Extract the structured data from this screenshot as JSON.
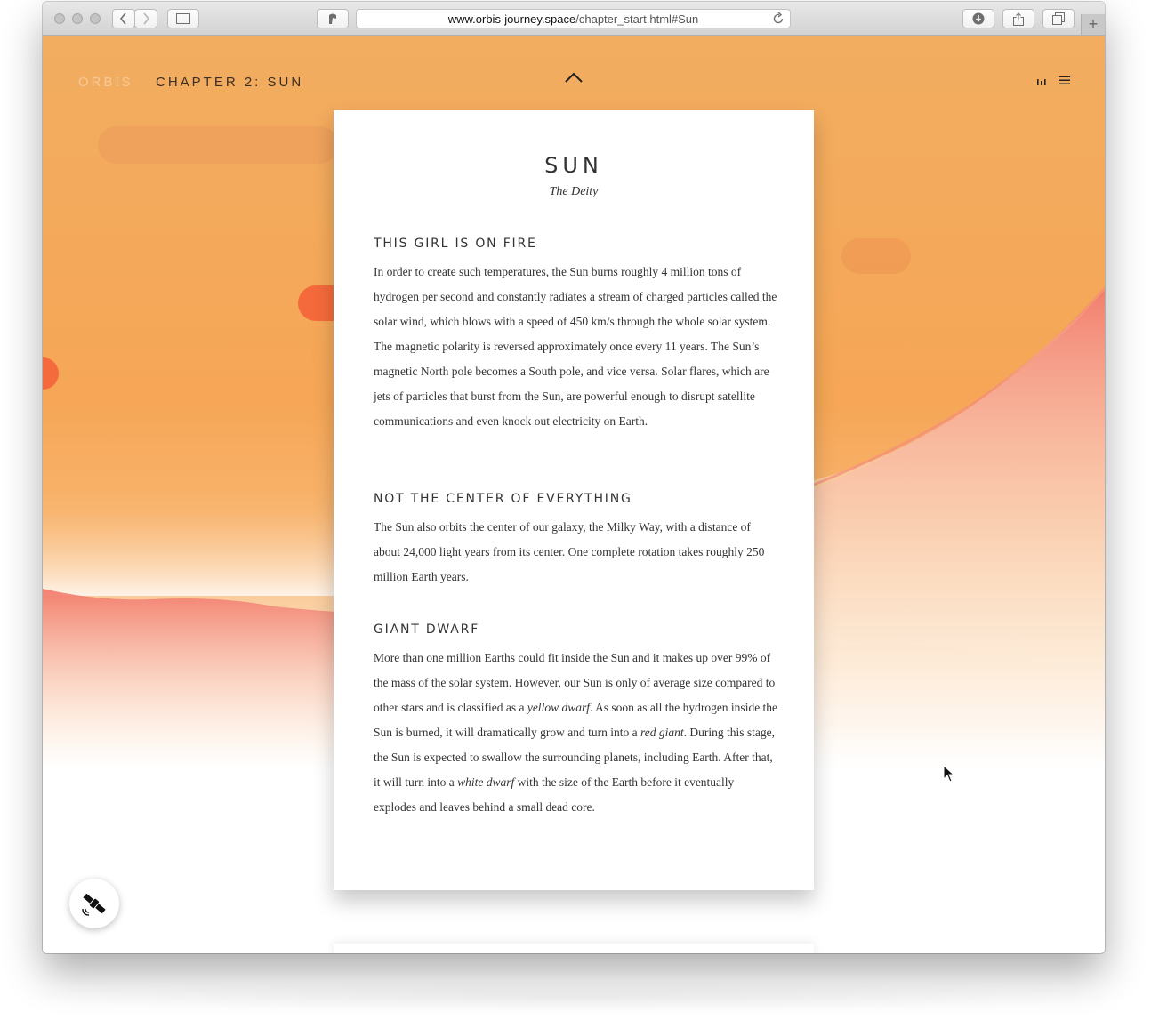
{
  "browser": {
    "url_host": "www.orbis-journey.space",
    "url_path": "/chapter_start.html#Sun"
  },
  "header": {
    "brand": "ORBIS",
    "chapter": "CHAPTER 2: SUN"
  },
  "card": {
    "title": "SUN",
    "subtitle": "The Deity",
    "sections": [
      {
        "heading": "THIS GIRL IS ON FIRE",
        "body": "In order to create such temperatures, the Sun burns roughly 4 million tons of hydrogen per second and constantly radiates a stream of charged particles called the solar wind, which blows with a speed of 450 km/s through the whole solar system. The magnetic polarity is reversed approximately once every 11 years. The Sun’s magnetic North pole becomes a South pole, and vice versa. Solar flares, which are jets of particles that burst from the Sun, are powerful enough to disrupt satellite communications and even knock out electricity on Earth."
      },
      {
        "heading": "NOT THE CENTER OF EVERYTHING",
        "body": "The Sun also orbits the center of our galaxy, the Milky Way, with a distance of about 24,000 light years from its center. One complete rotation takes roughly 250 million Earth years."
      },
      {
        "heading": "GIANT DWARF",
        "body_parts": [
          "More than one million Earths could fit inside the Sun and it makes up over 99% of the mass of the solar system. However, our Sun is only of average size compared to other stars and is classified as a ",
          "yellow dwarf",
          ". As soon as all the hydrogen inside the Sun is burned, it will dramatically grow and turn into a ",
          "red giant",
          ". During this stage, the Sun is expected to swallow the surrounding planets, including Earth. After that, it will turn into a ",
          "white dwarf",
          " with the size of the Earth before it eventually explodes and leaves behind a small dead core."
        ]
      }
    ]
  },
  "icons": {
    "up": "chevron-up-icon",
    "bars": "bar-chart-icon",
    "menu": "hamburger-menu-icon",
    "fab": "satellite-icon"
  },
  "colors": {
    "sun_orange": "#f6a656",
    "coral_band": "#f27a6b",
    "text": "#333333"
  }
}
